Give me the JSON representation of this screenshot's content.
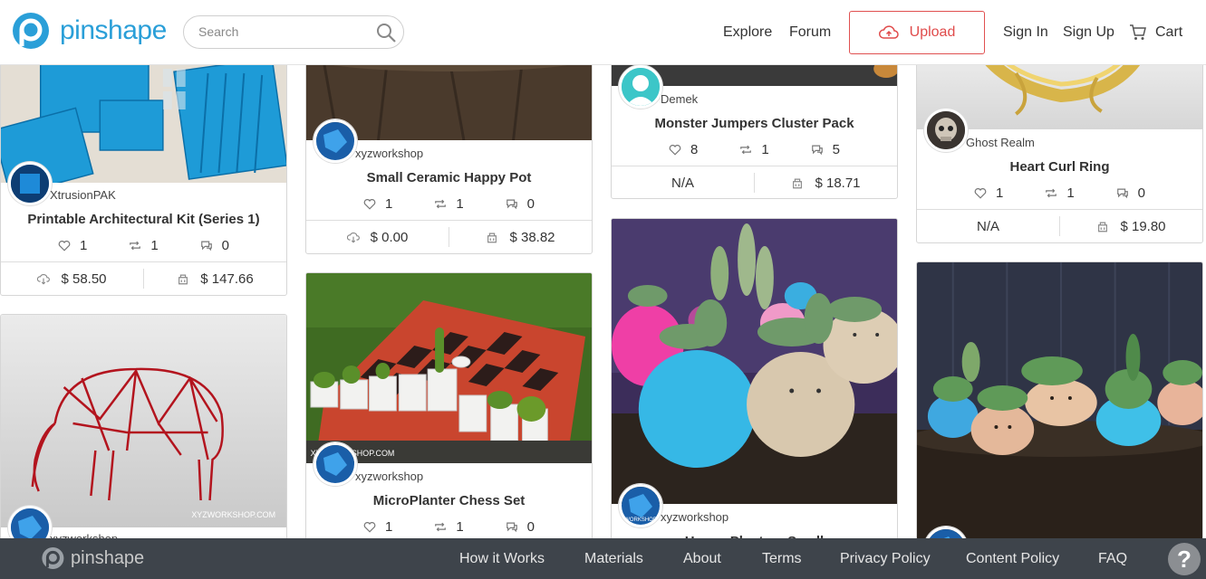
{
  "header": {
    "brand": "pinshape",
    "search_placeholder": "Search",
    "nav": {
      "explore": "Explore",
      "forum": "Forum",
      "upload": "Upload",
      "sign_in": "Sign In",
      "sign_up": "Sign Up",
      "cart": "Cart"
    }
  },
  "cards": [
    {
      "author": "XtrusionPAK",
      "title": "Printable Architectural Kit (Series 1)",
      "likes": "1",
      "remakes": "1",
      "comments": "0",
      "download_price": "$ 58.50",
      "print_price": "$ 147.66"
    },
    {
      "author": "xyzworkshop",
      "title": "Small Ceramic Happy Pot",
      "likes": "1",
      "remakes": "1",
      "comments": "0",
      "download_price": "$ 0.00",
      "print_price": "$ 38.82"
    },
    {
      "author": "Demek",
      "title": "Monster Jumpers Cluster Pack",
      "likes": "8",
      "remakes": "1",
      "comments": "5",
      "download_price": "N/A",
      "print_price": "$ 18.71"
    },
    {
      "author": "Ghost Realm",
      "title": "Heart Curl Ring",
      "likes": "1",
      "remakes": "1",
      "comments": "0",
      "download_price": "N/A",
      "print_price": "$ 19.80"
    },
    {
      "author": "xyzworkshop",
      "title": "MicroPlanter Chess Set",
      "likes": "1",
      "remakes": "1",
      "comments": "0"
    },
    {
      "author": "xyzworkshop",
      "title": "Happy Planters Small"
    },
    {
      "author": "xyzworkshop"
    }
  ],
  "image_watermarks": {
    "elephant": "XYZWORKSHOP.COM",
    "chess": "XYZWORKSHOP.COM",
    "avatar": "WORKSHOP"
  },
  "footer": {
    "brand": "pinshape",
    "links": [
      "How it Works",
      "Materials",
      "About",
      "Terms",
      "Privacy Policy",
      "Content Policy",
      "FAQ"
    ],
    "help": "?"
  },
  "colors": {
    "brand_blue": "#2a9fd8",
    "upload_red": "#e04b4b",
    "footer_bg": "#3e444b"
  }
}
